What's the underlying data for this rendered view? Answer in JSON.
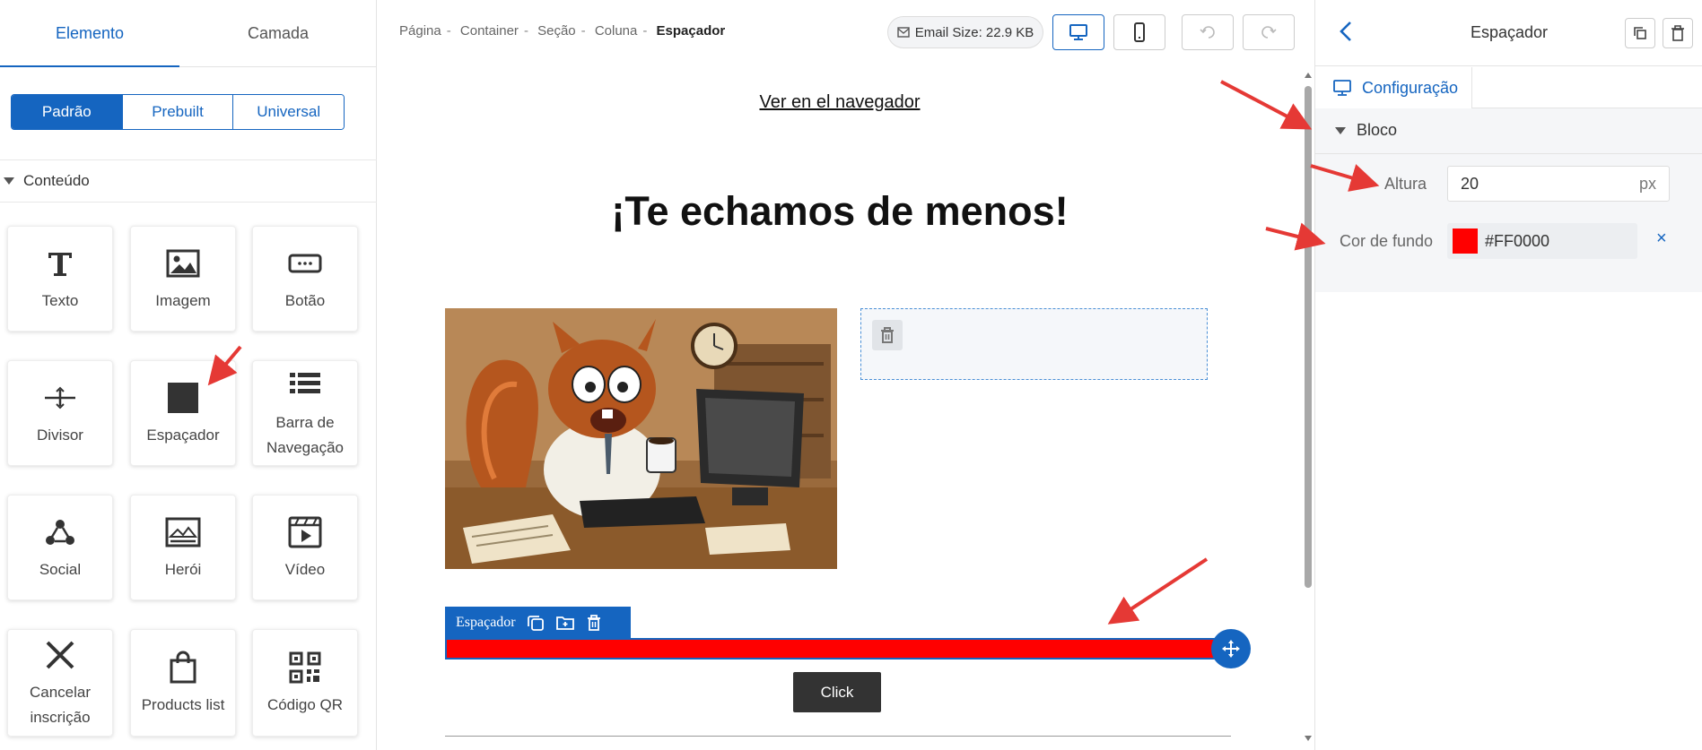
{
  "left_panel": {
    "tabs": [
      {
        "label": "Elemento",
        "active": true
      },
      {
        "label": "Camada",
        "active": false
      }
    ],
    "segments": [
      {
        "label": "Padrão",
        "active": true
      },
      {
        "label": "Prebuilt",
        "active": false
      },
      {
        "label": "Universal",
        "active": false
      }
    ],
    "section_title": "Conteúdo",
    "tiles": [
      {
        "label": "Texto",
        "icon": "text-icon"
      },
      {
        "label": "Imagem",
        "icon": "image-icon"
      },
      {
        "label": "Botão",
        "icon": "button-icon"
      },
      {
        "label": "Divisor",
        "icon": "divider-icon"
      },
      {
        "label": "Espaçador",
        "icon": "spacer-icon"
      },
      {
        "label": "Barra de Navegação",
        "icon": "navbar-icon"
      },
      {
        "label": "Social",
        "icon": "social-icon"
      },
      {
        "label": "Herói",
        "icon": "hero-icon"
      },
      {
        "label": "Vídeo",
        "icon": "video-icon"
      },
      {
        "label": "Cancelar inscrição",
        "icon": "unsubscribe-icon"
      },
      {
        "label": "Products list",
        "icon": "shopping-bag-icon"
      },
      {
        "label": "Código QR",
        "icon": "qr-code-icon"
      }
    ]
  },
  "toolbar": {
    "breadcrumbs": [
      "Página",
      "Container",
      "Seção",
      "Coluna",
      "Espaçador"
    ],
    "email_size": "Email Size: 22.9 KB",
    "device_modes": [
      {
        "name": "desktop",
        "icon": "desktop-icon",
        "active": true
      },
      {
        "name": "mobile",
        "icon": "mobile-icon",
        "active": false
      }
    ],
    "undo_icon": "undo-icon",
    "redo_icon": "redo-icon"
  },
  "canvas": {
    "view_link": "Ver en el navegador",
    "headline": "¡Te echamos de menos!",
    "spacer_toolbar_label": "Espaçador",
    "spacer_color": "#FF0000",
    "button_label": "Click"
  },
  "right_panel": {
    "title": "Espaçador",
    "tab_label": "Configuração",
    "section_title": "Bloco",
    "height_label": "Altura",
    "height_value": "20",
    "height_unit": "px",
    "bg_label": "Cor de fundo",
    "bg_value": "#FF0000",
    "clear_symbol": "×"
  },
  "colors": {
    "accent": "#1565c0",
    "spacer": "#ff0000",
    "annotation_arrow": "#e53935"
  }
}
